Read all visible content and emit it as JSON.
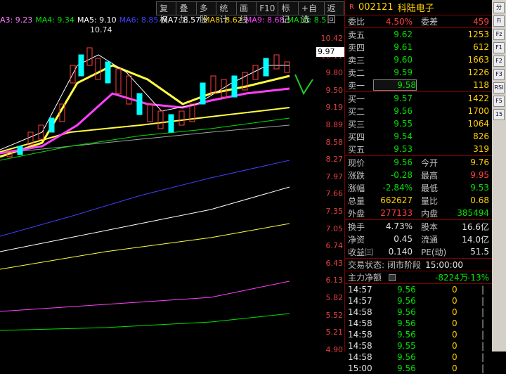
{
  "toolbar": [
    "复权",
    "叠加",
    "多股",
    "统计",
    "画线",
    "F10",
    "标记",
    "+自选",
    "返回"
  ],
  "ma_bar": [
    {
      "label": "A3: 9.23",
      "color": "#ff80ff"
    },
    {
      "label": "MA4: 9.34",
      "color": "#00e000"
    },
    {
      "label": "MA5: 9.10",
      "color": "#ffffff"
    },
    {
      "label": "MA6: 8.85",
      "color": "#4040ff"
    },
    {
      "label": "MA7: 8.57",
      "color": "#ffffff"
    },
    {
      "label": "MA8: 8.62",
      "color": "#ffd000"
    },
    {
      "label": "MA9: 8.68",
      "color": "#ff40ff"
    },
    {
      "label": "MA10: 8.5",
      "color": "#00e000"
    }
  ],
  "high_marker": "10.74",
  "current_price_box": "9.97",
  "price_axis": [
    "10.42",
    "10.11",
    "9.80",
    "9.50",
    "9.19",
    "8.89",
    "8.58",
    "8.27",
    "7.97",
    "7.66",
    "7.35",
    "7.05",
    "6.74",
    "6.43",
    "6.13",
    "5.82",
    "5.52",
    "5.21",
    "4.90"
  ],
  "stock": {
    "r_label": "R",
    "code": "002121",
    "name": "科陆电子"
  },
  "weibi": {
    "label": "委比",
    "value": "4.50%",
    "label2": "委差",
    "value2": "459"
  },
  "sell": [
    {
      "label": "卖五",
      "price": "9.62",
      "vol": "1253"
    },
    {
      "label": "卖四",
      "price": "9.61",
      "vol": "612"
    },
    {
      "label": "卖三",
      "price": "9.60",
      "vol": "1663"
    },
    {
      "label": "卖二",
      "price": "9.59",
      "vol": "1226"
    },
    {
      "label": "卖一",
      "price": "9.58",
      "vol": "118"
    }
  ],
  "buy": [
    {
      "label": "买一",
      "price": "9.57",
      "vol": "1422"
    },
    {
      "label": "买二",
      "price": "9.56",
      "vol": "1700"
    },
    {
      "label": "买三",
      "price": "9.55",
      "vol": "1064"
    },
    {
      "label": "买四",
      "price": "9.54",
      "vol": "826"
    },
    {
      "label": "买五",
      "price": "9.53",
      "vol": "319"
    }
  ],
  "quote": [
    {
      "l1": "现价",
      "v1": "9.56",
      "c1": "green",
      "l2": "今开",
      "v2": "9.76",
      "c2": "yellow"
    },
    {
      "l1": "涨跌",
      "v1": "-0.28",
      "c1": "green",
      "l2": "最高",
      "v2": "9.95",
      "c2": "red"
    },
    {
      "l1": "涨幅",
      "v1": "-2.84%",
      "c1": "green",
      "l2": "最低",
      "v2": "9.53",
      "c2": "green"
    },
    {
      "l1": "总量",
      "v1": "662627",
      "c1": "yellow",
      "l2": "量比",
      "v2": "0.68",
      "c2": "yellow"
    },
    {
      "l1": "外盘",
      "v1": "277133",
      "c1": "red",
      "l2": "内盘",
      "v2": "385494",
      "c2": "green"
    }
  ],
  "finance": [
    {
      "l1": "换手",
      "v1": "4.73%",
      "l2": "股本",
      "v2": "16.6亿"
    },
    {
      "l1": "净资",
      "v1": "0.45",
      "l2": "流通",
      "v2": "14.0亿"
    },
    {
      "l1": "收益㈢",
      "v1": "0.140",
      "l2": "PE(动)",
      "v2": "51.5"
    }
  ],
  "trade_status": {
    "label": "交易状态:",
    "value": "闭市阶段",
    "time": "15:00:00"
  },
  "main_flow": {
    "label": "主力净额",
    "value": "-8224万",
    "pct": "-13%"
  },
  "ticks": [
    {
      "t": "14:57",
      "p": "9.56",
      "q": "0"
    },
    {
      "t": "14:57",
      "p": "9.56",
      "q": "0"
    },
    {
      "t": "14:58",
      "p": "9.56",
      "q": "0"
    },
    {
      "t": "14:58",
      "p": "9.56",
      "q": "0"
    },
    {
      "t": "14:58",
      "p": "9.56",
      "q": "0"
    },
    {
      "t": "14:58",
      "p": "9.55",
      "q": "0"
    },
    {
      "t": "14:58",
      "p": "9.56",
      "q": "0"
    },
    {
      "t": "15:00",
      "p": "9.56",
      "q": "0"
    }
  ],
  "right_icons": [
    "分",
    "Fi",
    "Fz",
    "F1",
    "F2",
    "F3",
    "RSI",
    "F5",
    "15"
  ]
}
